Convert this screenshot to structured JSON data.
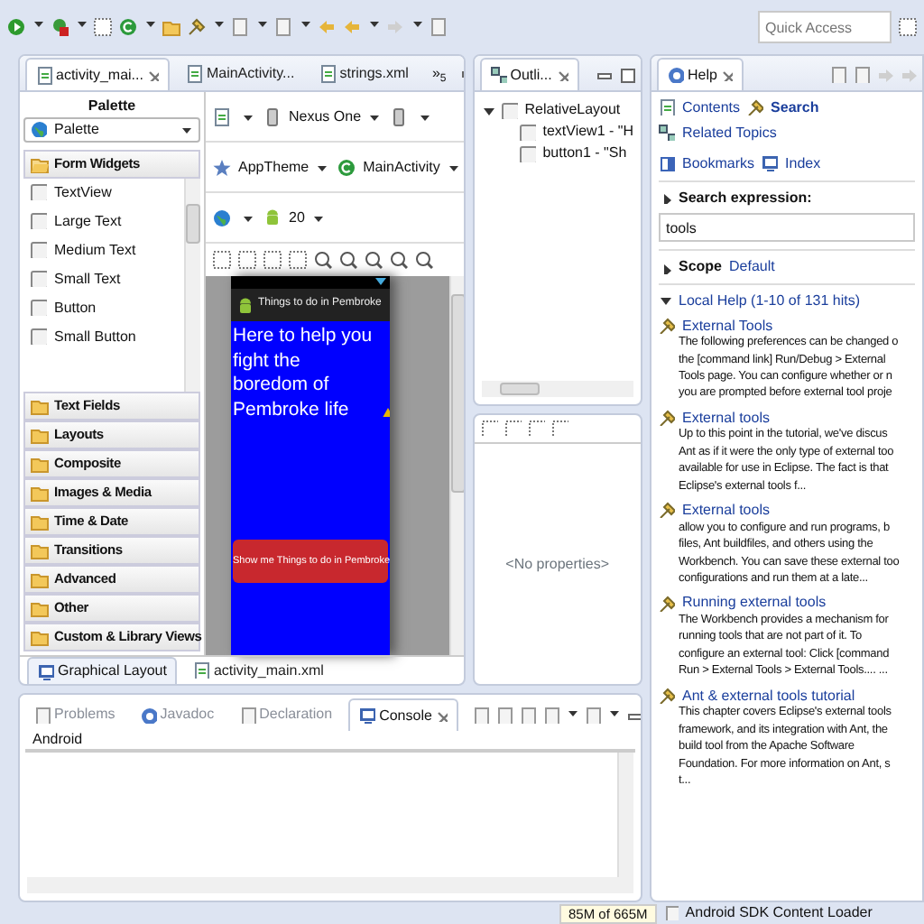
{
  "toolbar": {
    "quick_access": {
      "placeholder": "Quick Access"
    }
  },
  "editor": {
    "tabs": [
      {
        "label": "activity_mai...",
        "selected": true
      },
      {
        "label": "MainActivity...",
        "selected": false
      },
      {
        "label": "strings.xml",
        "selected": false
      }
    ],
    "overflow": "»$_{5}$",
    "palette": {
      "title": "Palette",
      "dropdown": "Palette",
      "categories": [
        {
          "label": "Form Widgets",
          "expanded": true,
          "items": [
            "TextView",
            "Large Text",
            "Medium Text",
            "Small Text",
            "Button",
            "Small Button"
          ]
        },
        {
          "label": "Text Fields",
          "expanded": false
        },
        {
          "label": "Layouts",
          "expanded": false
        },
        {
          "label": "Composite",
          "expanded": false
        },
        {
          "label": "Images & Media",
          "expanded": false
        },
        {
          "label": "Time & Date",
          "expanded": false
        },
        {
          "label": "Transitions",
          "expanded": false
        },
        {
          "label": "Advanced",
          "expanded": false
        },
        {
          "label": "Other",
          "expanded": false
        },
        {
          "label": "Custom & Library Views",
          "expanded": false
        }
      ]
    },
    "canvas_toolbar": {
      "device": "Nexus One",
      "theme": "AppTheme",
      "activity": "MainActivity",
      "api_level": "20"
    },
    "preview": {
      "app_title": "Things to do in Pembroke",
      "text": "Here to help you fight the boredom of Pembroke life",
      "button": "Show me Things to do in Pembroke"
    },
    "bottom_tabs": [
      {
        "label": "Graphical Layout",
        "selected": true
      },
      {
        "label": "activity_main.xml",
        "selected": false
      }
    ]
  },
  "outline": {
    "title": "Outli...",
    "tree": [
      {
        "label": "RelativeLayout",
        "expanded": true,
        "children": [
          {
            "label": "textView1 - \"H"
          },
          {
            "label": "button1 - \"Sh"
          }
        ]
      }
    ]
  },
  "properties": {
    "empty_text": "<No properties>"
  },
  "help": {
    "title": "Help",
    "links": [
      {
        "label": "Contents",
        "selected": false
      },
      {
        "label": "Search",
        "selected": true
      },
      {
        "label": "Related Topics",
        "selected": false
      },
      {
        "label": "Bookmarks",
        "selected": false
      },
      {
        "label": "Index",
        "selected": false
      }
    ],
    "search_expression": {
      "label": "Search expression:",
      "expanded": false,
      "value": "tools"
    },
    "scope": {
      "label": "Scope",
      "value": "Default",
      "expanded": false
    },
    "local_help": {
      "label": "Local Help (1-10 of 131 hits)",
      "expanded": true
    },
    "results": [
      {
        "title": "External Tools",
        "lines": [
          "The following preferences can be changed o",
          "the [command link] Run/Debug > External",
          "Tools page. You can configure whether or n",
          "you are prompted before external tool proje"
        ]
      },
      {
        "title": "External tools",
        "lines": [
          "Up to this point in the tutorial, we've discus",
          "Ant as if it were the only type of external too",
          "available for use in Eclipse. The fact is that",
          "Eclipse's external tools f..."
        ]
      },
      {
        "title": "External tools",
        "lines": [
          "allow you to configure and run programs, b",
          "files, Ant buildfiles, and others using the",
          "Workbench. You can save these external too",
          "configurations and run them at a late..."
        ]
      },
      {
        "title": "Running external tools",
        "lines": [
          "The Workbench provides a mechanism for",
          "running tools that are not part of it. To",
          "configure an external tool: Click [command",
          "Run > External Tools > External Tools.... ..."
        ]
      },
      {
        "title": "Ant & external tools tutorial",
        "lines": [
          "This chapter covers Eclipse's external tools",
          "framework, and its integration with Ant, the",
          "build tool from the Apache Software",
          "Foundation. For more information on Ant, s",
          "t..."
        ]
      }
    ]
  },
  "console": {
    "tabs": [
      {
        "label": "Problems",
        "selected": false
      },
      {
        "label": "Javadoc",
        "selected": false
      },
      {
        "label": "Declaration",
        "selected": false
      },
      {
        "label": "Console",
        "selected": true
      }
    ],
    "label": "Android"
  },
  "status_bar": {
    "memory": "85M of 665M",
    "job": "Android SDK Content Loader"
  }
}
